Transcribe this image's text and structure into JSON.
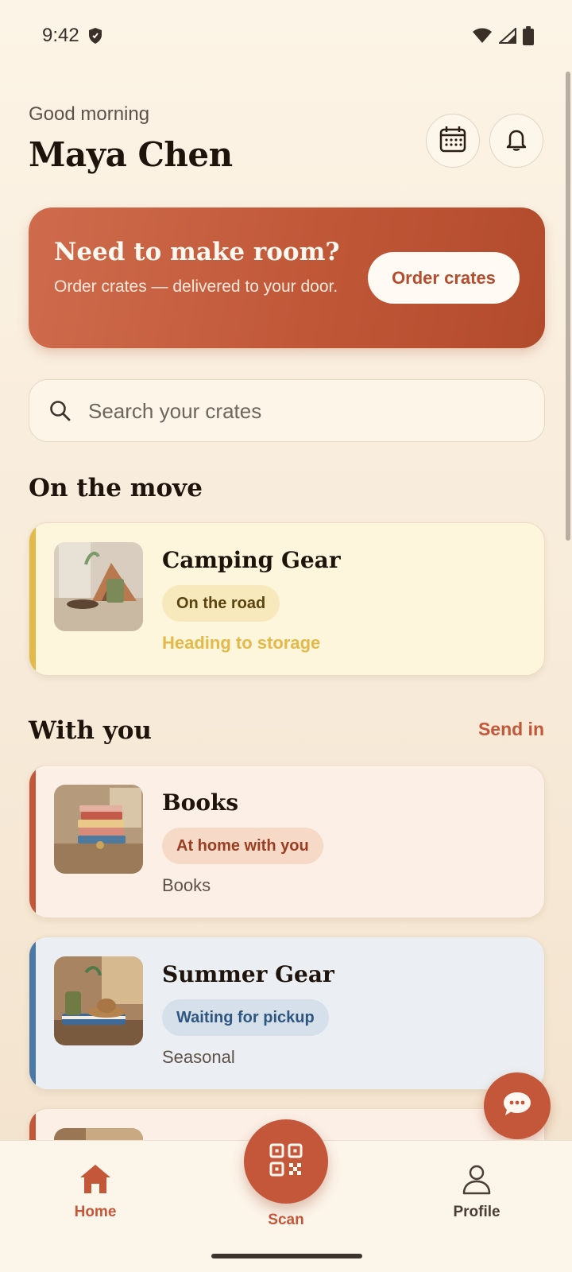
{
  "status_bar": {
    "time": "9:42"
  },
  "header": {
    "greeting": "Good morning",
    "name": "Maya Chen"
  },
  "promo": {
    "title": "Need to make room?",
    "subtitle": "Order crates — delivered to your door.",
    "button_label": "Order crates"
  },
  "search": {
    "placeholder": "Search your crates"
  },
  "sections": {
    "on_the_move": {
      "title": "On the move"
    },
    "with_you": {
      "title": "With you",
      "action_label": "Send in"
    }
  },
  "cards": [
    {
      "title": "Camping Gear",
      "badge": "On the road",
      "subtitle": "Heading to storage",
      "accent": "#e3b94a"
    },
    {
      "title": "Books",
      "badge": "At home with you",
      "subtitle": "Books",
      "accent": "#c4573a"
    },
    {
      "title": "Summer Gear",
      "badge": "Waiting for pickup",
      "subtitle": "Seasonal",
      "accent": "#4a78a8"
    }
  ],
  "nav": {
    "home": "Home",
    "scan": "Scan",
    "profile": "Profile"
  },
  "colors": {
    "accent": "#c4573a",
    "background": "#fcf4e6",
    "promo": "#c05838"
  }
}
